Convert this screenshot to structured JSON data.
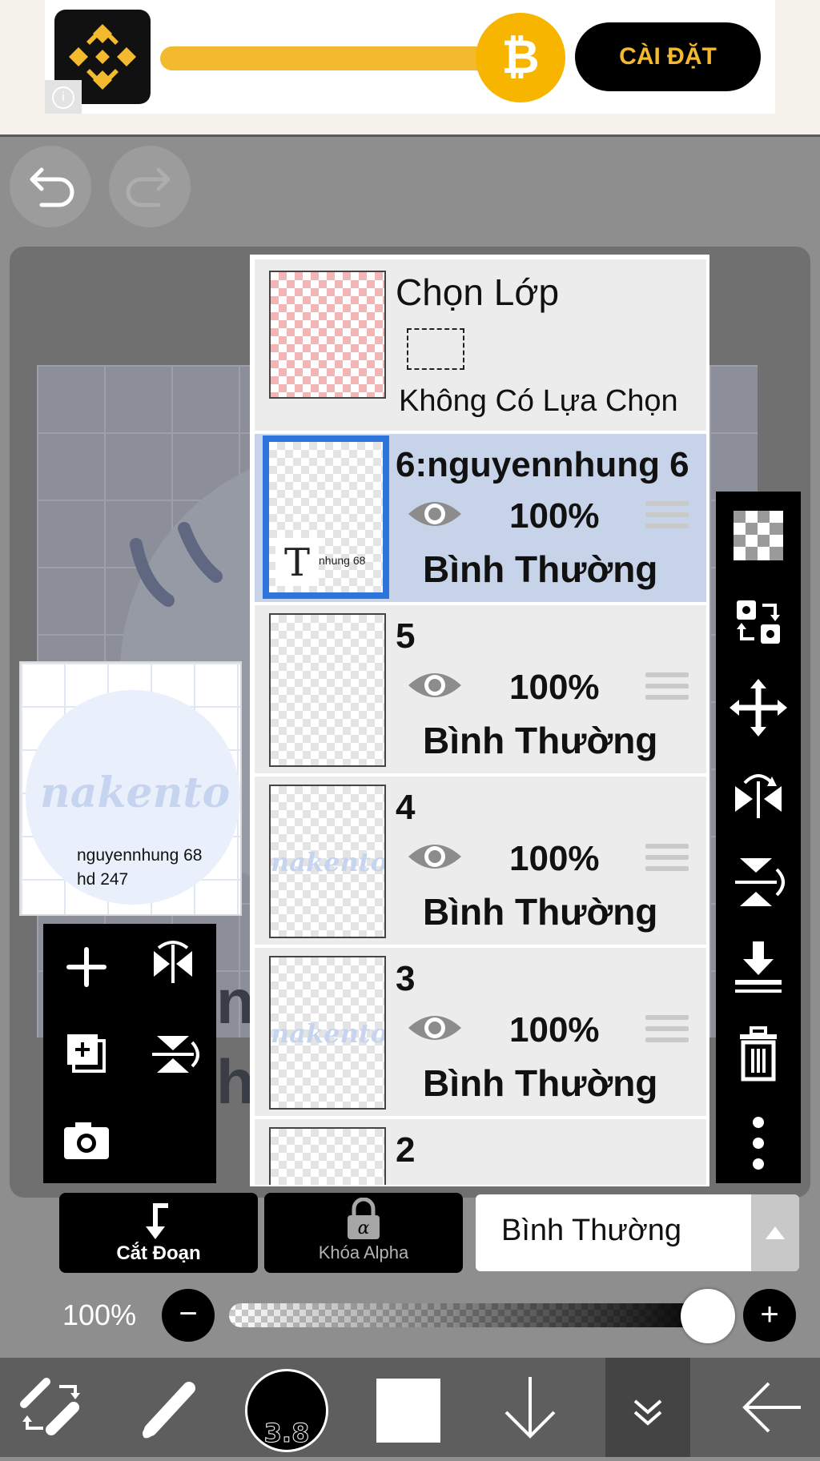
{
  "ad": {
    "button_label": "CÀI ĐẶT",
    "info_icon": "info-icon",
    "coin_symbol": "₿"
  },
  "toolbar": {
    "undo_icon": "undo-icon",
    "redo_icon": "redo-icon"
  },
  "canvas": {
    "partial_text_1": "n",
    "partial_text_2": "h"
  },
  "preview": {
    "logo_text": "nakento",
    "caption": "nguyennhung 68\nhd 247"
  },
  "layers": {
    "select_layer": {
      "title": "Chọn Lớp",
      "subtitle": "Không Có Lựa Chọn"
    },
    "rows": [
      {
        "name": "6:nguyennhung 6",
        "opacity": "100%",
        "mode": "Bình Thường",
        "thumb_text": "nhung 68",
        "selected": true
      },
      {
        "name": "5",
        "opacity": "100%",
        "mode": "Bình Thường"
      },
      {
        "name": "4",
        "opacity": "100%",
        "mode": "Bình Thường",
        "thumb_logo": "nakento"
      },
      {
        "name": "3",
        "opacity": "100%",
        "mode": "Bình Thường",
        "thumb_logo": "nakento"
      },
      {
        "name": "2"
      }
    ]
  },
  "layer_controls": {
    "clip_label": "Cắt Đoạn",
    "alpha_label": "Khóa Alpha",
    "blend_mode": "Bình Thường",
    "opacity_label": "100%",
    "opacity_value": 1.0
  },
  "bottom_bar": {
    "brush_size": "3.8",
    "color": "#ffffff"
  }
}
